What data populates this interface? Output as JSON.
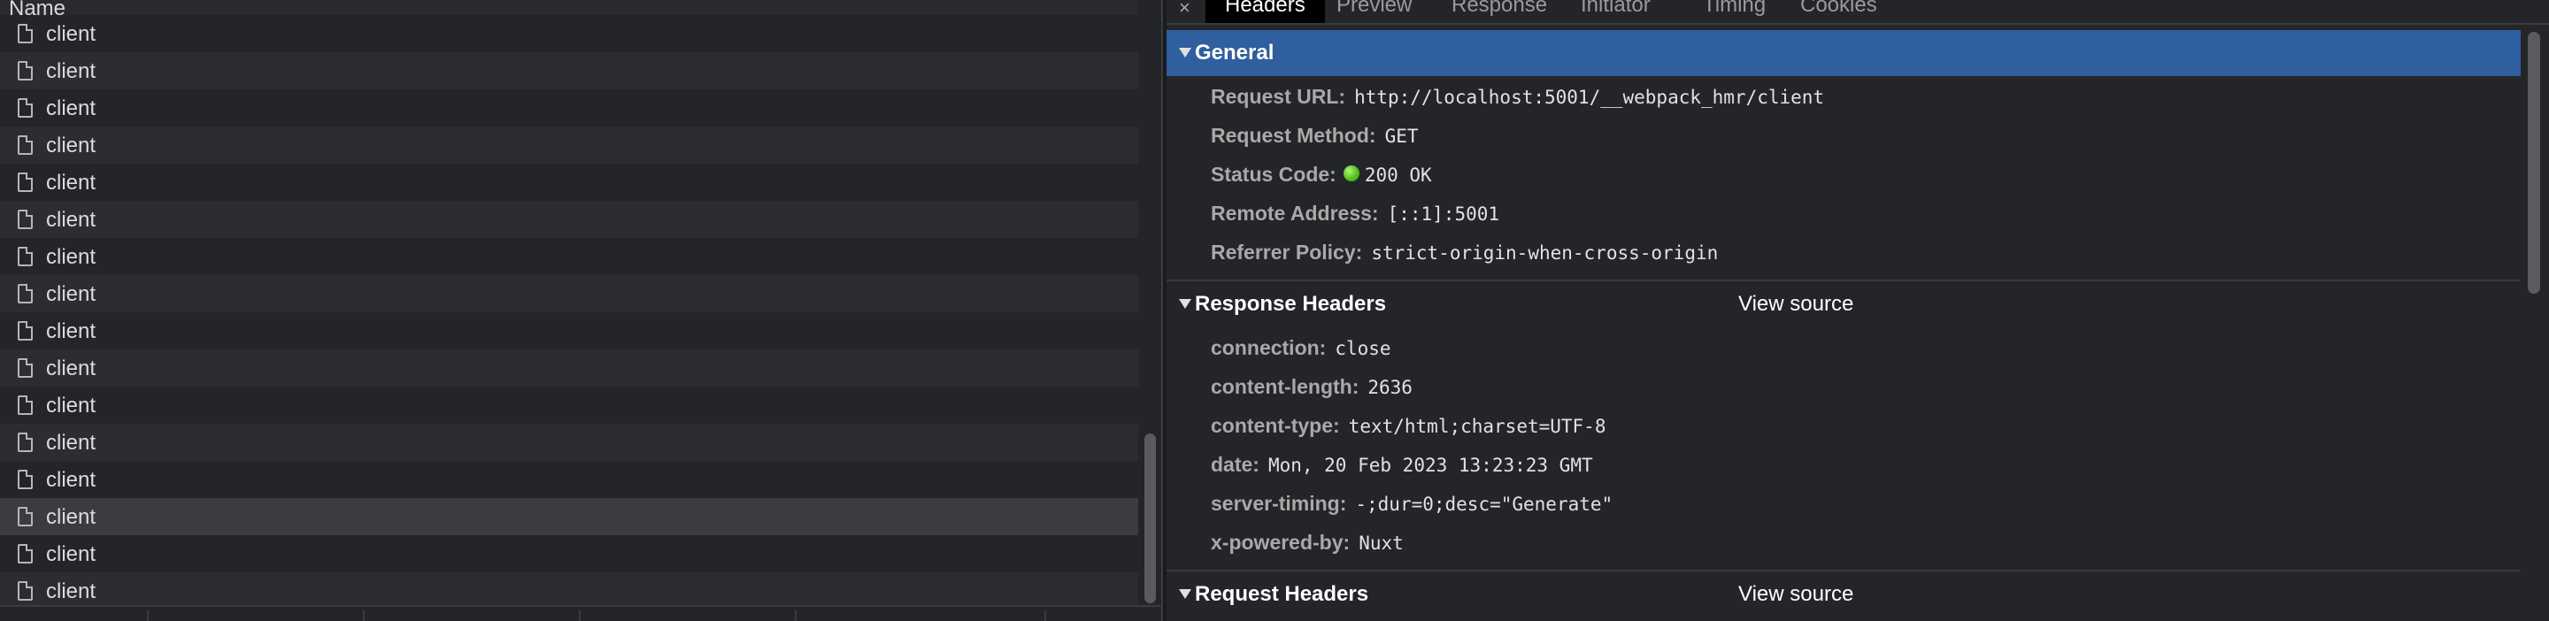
{
  "list": {
    "header": "Name",
    "rows": [
      {
        "name": "client"
      },
      {
        "name": "client"
      },
      {
        "name": "client"
      },
      {
        "name": "client"
      },
      {
        "name": "client"
      },
      {
        "name": "client"
      },
      {
        "name": "client"
      },
      {
        "name": "client"
      },
      {
        "name": "client"
      },
      {
        "name": "client"
      },
      {
        "name": "client"
      },
      {
        "name": "client"
      },
      {
        "name": "client"
      },
      {
        "name": "client",
        "selected": true
      },
      {
        "name": "client"
      },
      {
        "name": "client"
      }
    ]
  },
  "details": {
    "close_glyph": "×",
    "tabs": [
      {
        "label": "Headers",
        "active": true
      },
      {
        "label": "Preview"
      },
      {
        "label": "Response"
      },
      {
        "label": "Initiator"
      },
      {
        "label": "Timing"
      },
      {
        "label": "Cookies"
      }
    ],
    "general": {
      "title": "General",
      "request_url": {
        "key": "Request URL:",
        "value": "http://localhost:5001/__webpack_hmr/client"
      },
      "request_method": {
        "key": "Request Method:",
        "value": "GET"
      },
      "status_code": {
        "key": "Status Code:",
        "value": "200 OK",
        "status_color": "#5fcc2a"
      },
      "remote_address": {
        "key": "Remote Address:",
        "value": "[::1]:5001"
      },
      "referrer_policy": {
        "key": "Referrer Policy:",
        "value": "strict-origin-when-cross-origin"
      }
    },
    "response_headers": {
      "title": "Response Headers",
      "view_source": "View source",
      "items": [
        {
          "key": "connection:",
          "value": "close"
        },
        {
          "key": "content-length:",
          "value": "2636"
        },
        {
          "key": "content-type:",
          "value": "text/html;charset=UTF-8"
        },
        {
          "key": "date:",
          "value": "Mon, 20 Feb 2023 13:23:23 GMT"
        },
        {
          "key": "server-timing:",
          "value": "-;dur=0;desc=\"Generate\""
        },
        {
          "key": "x-powered-by:",
          "value": "Nuxt"
        }
      ]
    },
    "request_headers": {
      "title": "Request Headers",
      "view_source": "View source"
    }
  },
  "colors": {
    "section_highlight": "#2f5f9e",
    "background": "#242528",
    "selected_row": "#3b3c3f"
  }
}
